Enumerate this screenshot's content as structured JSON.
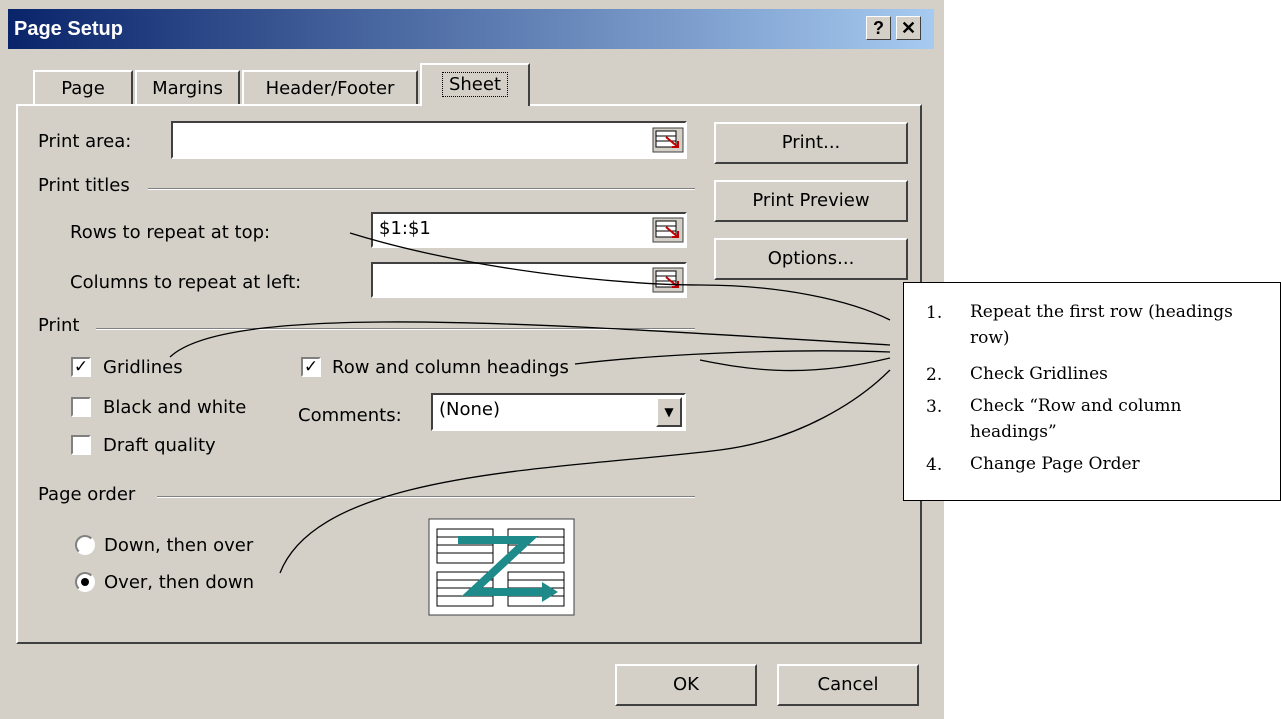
{
  "window": {
    "title": "Page Setup",
    "help_label": "?",
    "close_label": "✕"
  },
  "tabs": [
    {
      "label": "Page"
    },
    {
      "label": "Margins"
    },
    {
      "label": "Header/Footer"
    },
    {
      "label": "Sheet",
      "active": true
    }
  ],
  "sheet": {
    "print_area_label": "Print area:",
    "print_area_value": "",
    "print_titles_label": "Print titles",
    "rows_repeat_label": "Rows to repeat at top:",
    "rows_repeat_value": "$1:$1",
    "cols_repeat_label": "Columns to repeat at left:",
    "cols_repeat_value": "",
    "print_group_label": "Print",
    "gridlines_label": "Gridlines",
    "gridlines_checked": true,
    "black_white_label": "Black and white",
    "black_white_checked": false,
    "draft_quality_label": "Draft quality",
    "draft_quality_checked": false,
    "row_col_headings_label": "Row and column headings",
    "row_col_headings_checked": true,
    "comments_label": "Comments:",
    "comments_value": "(None)",
    "page_order_label": "Page order",
    "down_then_over_label": "Down, then over",
    "over_then_down_label": "Over, then down",
    "selected_page_order": "Over, then down"
  },
  "side_buttons": {
    "print": "Print...",
    "print_preview": "Print Preview",
    "options": "Options..."
  },
  "footer_buttons": {
    "ok": "OK",
    "cancel": "Cancel"
  },
  "annotation": {
    "items": [
      {
        "num": "1.",
        "text": "Repeat the first row (headings row)"
      },
      {
        "num": "2.",
        "text": "Check Gridlines"
      },
      {
        "num": "3.",
        "text": "Check “Row and column headings”"
      },
      {
        "num": "4.",
        "text": "Change Page Order"
      }
    ]
  },
  "colors": {
    "dialog_bg": "#d4d0c8",
    "titlebar_start": "#0a246a",
    "titlebar_end": "#a6caf0",
    "page_order_icon": "#1f8a8a"
  }
}
